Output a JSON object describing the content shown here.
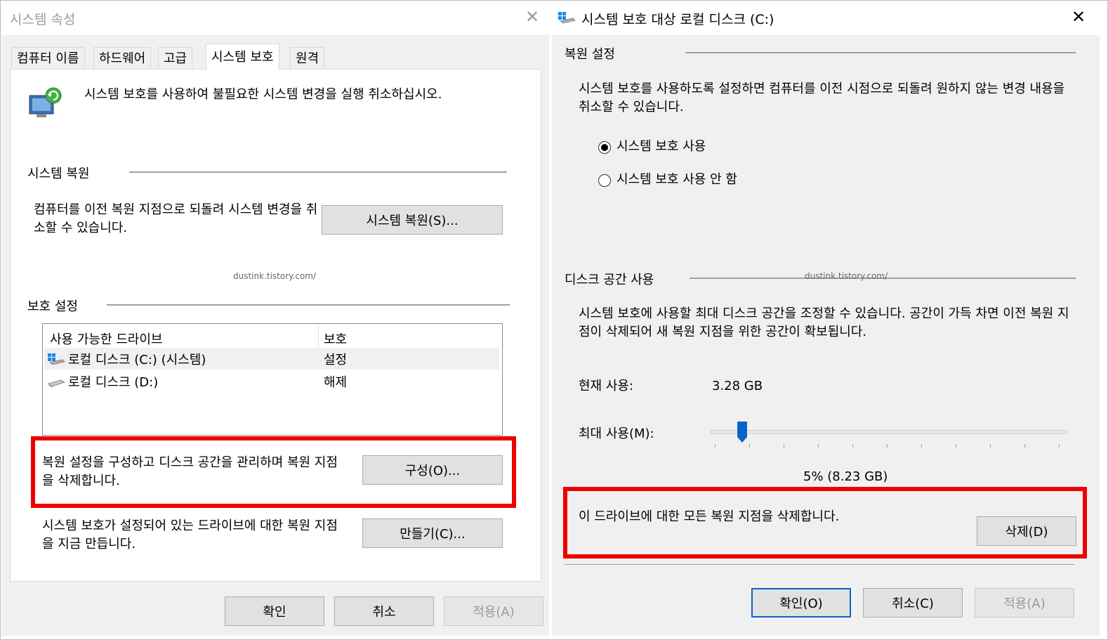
{
  "left": {
    "title": "시스템 속성",
    "close_glyph": "✕",
    "tabs": [
      "컴퓨터 이름",
      "하드웨어",
      "고급",
      "시스템 보호",
      "원격"
    ],
    "header_text": "시스템 보호를 사용하여 불필요한 시스템 변경을 실행 취소하십시오.",
    "restore": {
      "group_title": "시스템 복원",
      "text": "컴퓨터를 이전 복원 지점으로 되돌려 시스템 변경을 취소할 수 있습니다.",
      "button": "시스템 복원(S)..."
    },
    "watermark": "dustink.tistory.com/",
    "protection": {
      "group_title": "보호 설정",
      "col_drive": "사용 가능한 드라이브",
      "col_protect": "보호",
      "drives": [
        {
          "name": "로컬 디스크 (C:) (시스템)",
          "status": "설정"
        },
        {
          "name": "로컬 디스크 (D:)",
          "status": "해제"
        }
      ],
      "configure_text": "복원 설정을 구성하고 디스크 공간을 관리하며 복원 지점을 삭제합니다.",
      "configure_button": "구성(O)...",
      "create_text": "시스템 보호가 설정되어 있는 드라이브에 대한 복원 지점을 지금 만듭니다.",
      "create_button": "만들기(C)..."
    },
    "buttons": {
      "ok": "확인",
      "cancel": "취소",
      "apply": "적용(A)"
    }
  },
  "right": {
    "title": "시스템 보호 대상 로컬 디스크 (C:)",
    "close_glyph": "✕",
    "restore_settings": {
      "group_title": "복원 설정",
      "text": "시스템 보호를 사용하도록 설정하면 컴퓨터를 이전 시점으로 되돌려 원하지 않는 변경 내용을 취소할 수 있습니다.",
      "options": [
        {
          "label": "시스템 보호 사용",
          "selected": true
        },
        {
          "label": "시스템 보호 사용 안 함",
          "selected": false
        }
      ]
    },
    "disk_usage": {
      "group_title": "디스크 공간 사용",
      "watermark": "dustink.tistory.com/",
      "text": "시스템 보호에 사용할 최대 디스크 공간을 조정할 수 있습니다. 공간이 가득 차면 이전 복원 지점이 삭제되어 새 복원 지점을 위한 공간이 확보됩니다.",
      "current_label": "현재 사용:",
      "current_value": "3.28 GB",
      "max_label": "최대 사용(M):",
      "slider_percent": 5,
      "slider_value": "5% (8.23 GB)",
      "delete_text": "이 드라이브에 대한 모든 복원 지점을 삭제합니다.",
      "delete_button": "삭제(D)"
    },
    "buttons": {
      "ok": "확인(O)",
      "cancel": "취소(C)",
      "apply": "적용(A)"
    }
  },
  "colors": {
    "highlight": "#ee0000",
    "default_button_border": "#0a64c8"
  }
}
